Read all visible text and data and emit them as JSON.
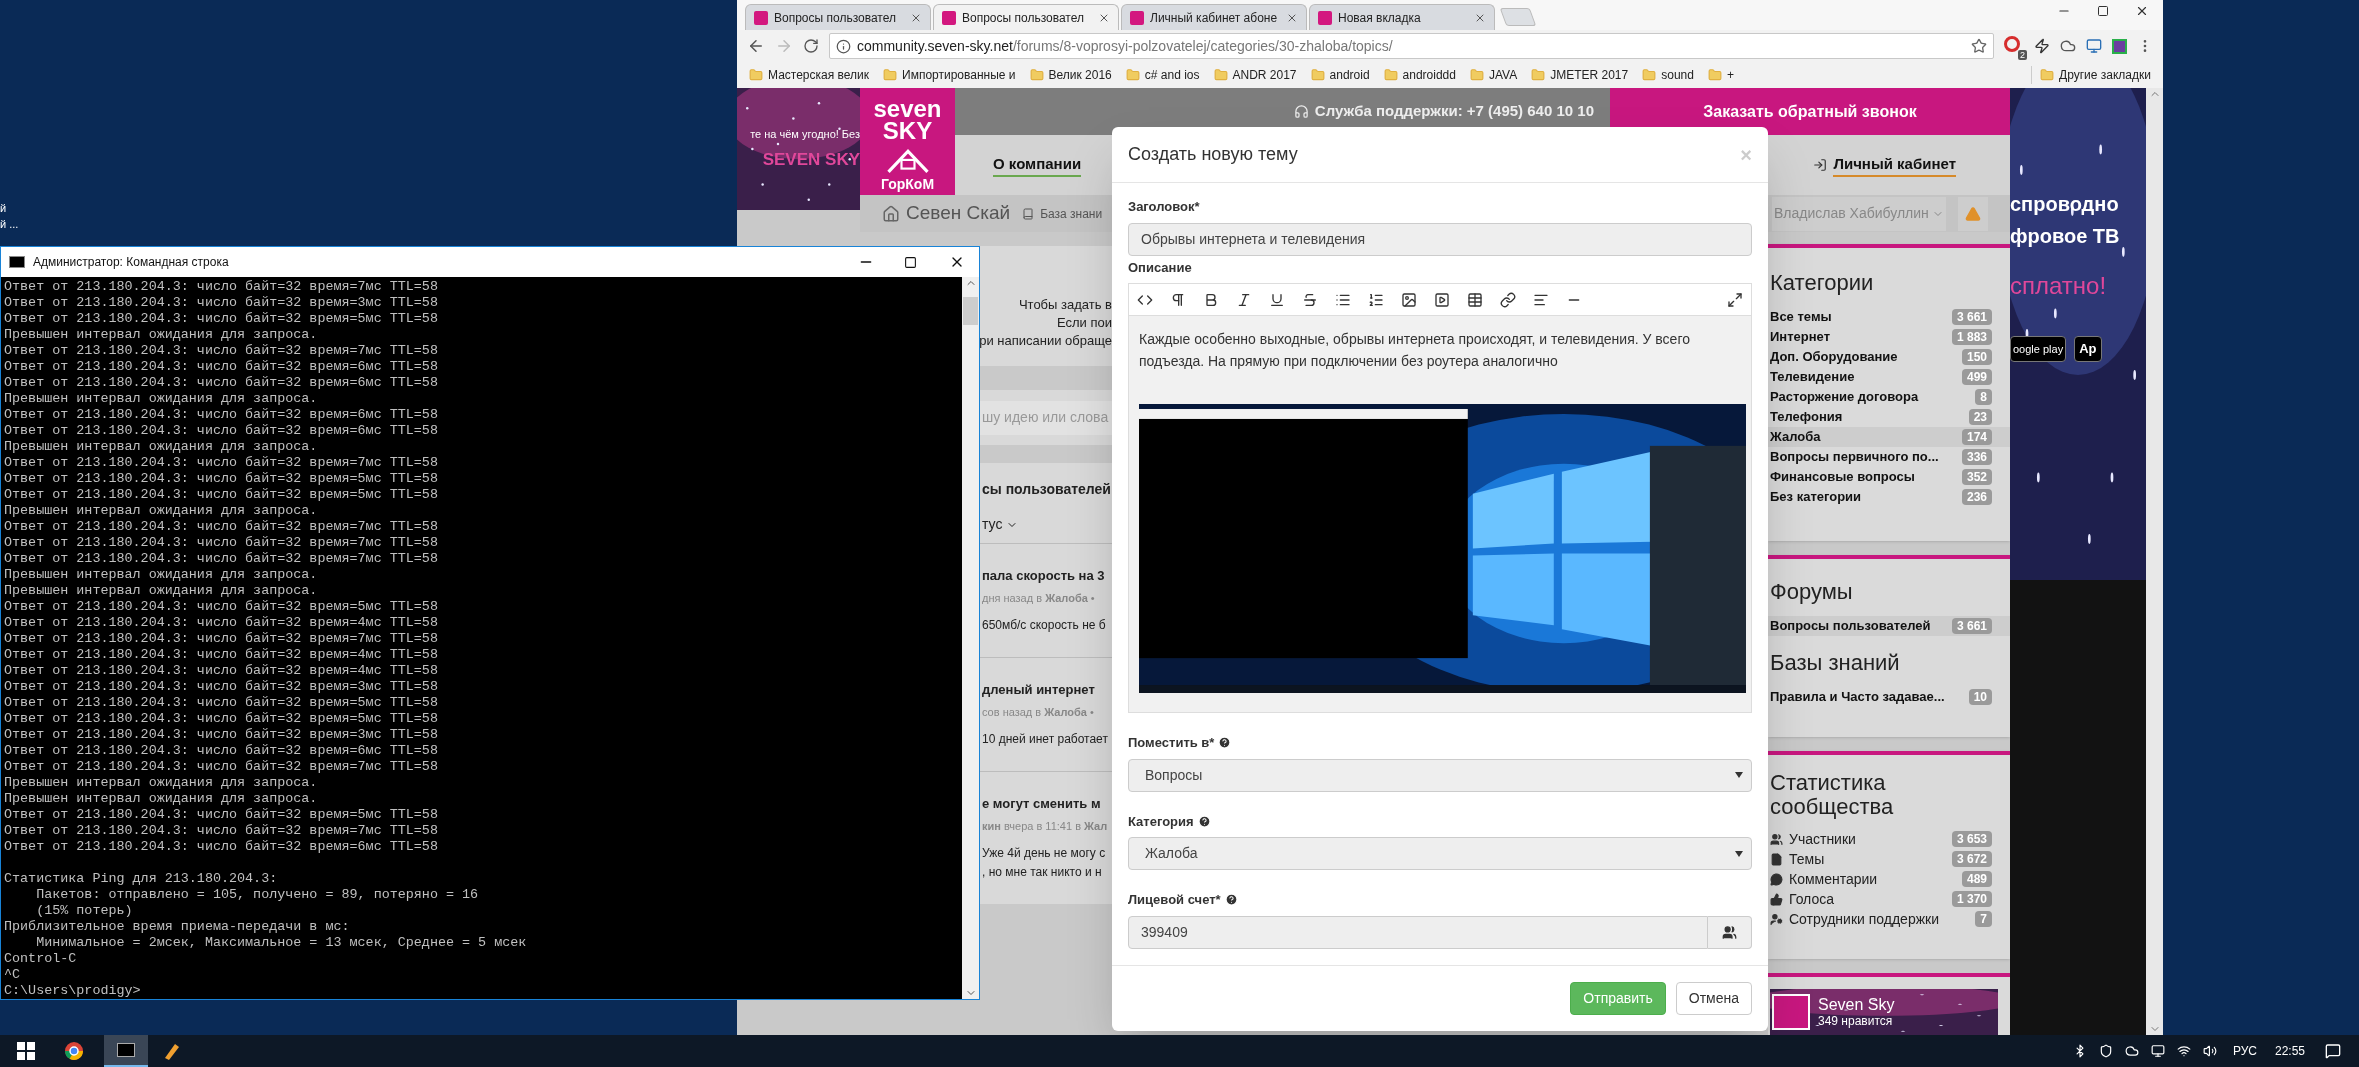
{
  "desktop": {
    "icon_labels": [
      "й",
      "й ..."
    ]
  },
  "browser": {
    "tabs": [
      {
        "label": "Вопросы пользовател",
        "selected": false
      },
      {
        "label": "Вопросы пользовател",
        "selected": true
      },
      {
        "label": "Личный кабинет абоне",
        "selected": false
      },
      {
        "label": "Новая вкладка",
        "selected": false
      }
    ],
    "address": {
      "host": "community.seven-sky.net",
      "path": "/forums/8-voprosyi-polzovatelej/categories/30-zhaloba/topics/"
    },
    "extension_badge": "2",
    "bookmarks": [
      "Мастерская велик",
      "Импортированные и",
      "Велик 2016",
      "c# and ios",
      "ANDR 2017",
      "android",
      "androiddd",
      "JAVA",
      "JMETER 2017",
      "sound",
      "+"
    ],
    "other_bookmarks": "Другие закладки"
  },
  "page": {
    "left_banner": {
      "slogan": "те на чём угодно! Без",
      "brand": "SEVEN SKY"
    },
    "logo": {
      "top": "seven",
      "bottom": "SKY",
      "sub": "ГорКоМ"
    },
    "support": "Служба поддержки: +7 (495) 640 10 10",
    "callback": "Заказать обратный звонок",
    "nav": [
      "О компании",
      "Личный кабинет"
    ],
    "breadcrumb": [
      "Севен Скай",
      "База знани"
    ],
    "user": "Владислав Хабибуллин",
    "intro_lines": [
      "Чтобы задать в",
      "Если пои",
      "ри написании обраще"
    ],
    "search_placeholder": "шу идею или слова",
    "forum_title": "сы пользователей",
    "filter": "тус",
    "topics": [
      {
        "title": "пала скорость на 3",
        "meta": "дня назад в **Жалоба** •",
        "excerpt": [
          "650мб/с скорость не б"
        ]
      },
      {
        "title": "дленый интернет",
        "meta": "сов назад в **Жалоба** •",
        "excerpt": [
          "10 дней инет работает"
        ]
      },
      {
        "title": "е могут сменить м",
        "meta": "**кин** вчера в 11:41 в **Жал**",
        "excerpt": [
          "Уже 4й день не могу с",
          ", но мне так никто и н"
        ]
      }
    ],
    "categories": {
      "title": "Категории",
      "items": [
        {
          "name": "Все темы",
          "count": "3 661",
          "selected": false
        },
        {
          "name": "Интернет",
          "count": "1 883",
          "selected": false
        },
        {
          "name": "Доп. Оборудование",
          "count": "150",
          "selected": false
        },
        {
          "name": "Телевидение",
          "count": "499",
          "selected": false
        },
        {
          "name": "Расторжение договора",
          "count": "8",
          "selected": false
        },
        {
          "name": "Телефония",
          "count": "23",
          "selected": false
        },
        {
          "name": "Жалоба",
          "count": "174",
          "selected": true
        },
        {
          "name": "Вопросы первичного по...",
          "count": "336",
          "selected": false
        },
        {
          "name": "Финансовые вопросы",
          "count": "352",
          "selected": false
        },
        {
          "name": "Без категории",
          "count": "236",
          "selected": false
        }
      ]
    },
    "forums": {
      "title": "Форумы",
      "items": [
        {
          "name": "Вопросы пользователей",
          "count": "3 661",
          "selected": true
        }
      ]
    },
    "knowledge": {
      "title": "Базы знаний",
      "items": [
        {
          "name": "Правила и Часто задавае...",
          "count": "10",
          "selected": false
        }
      ]
    },
    "stats": {
      "title": "Статистика сообщества",
      "items": [
        {
          "kind": "members",
          "label": "Участники",
          "count": "3 653"
        },
        {
          "kind": "topics",
          "label": "Темы",
          "count": "3 672"
        },
        {
          "kind": "comments",
          "label": "Комментарии",
          "count": "489"
        },
        {
          "kind": "votes",
          "label": "Голоса",
          "count": "1 370"
        },
        {
          "kind": "staff",
          "label": "Сотрудники поддержки",
          "count": "7"
        }
      ]
    },
    "social": {
      "name": "Seven Sky",
      "likes": "349 нравится"
    },
    "ad": {
      "lines": [
        "спроводно",
        "фровое ТВ"
      ],
      "highlight": "сплатно!",
      "stores": [
        "oogle play",
        "Ap"
      ]
    }
  },
  "cmd": {
    "title": "Администратор: Командная строка",
    "lines": [
      "Ответ от 213.180.204.3: число байт=32 время=7мс TTL=58",
      "Ответ от 213.180.204.3: число байт=32 время=3мс TTL=58",
      "Ответ от 213.180.204.3: число байт=32 время=5мс TTL=58",
      "Превышен интервал ожидания для запроса.",
      "Ответ от 213.180.204.3: число байт=32 время=7мс TTL=58",
      "Ответ от 213.180.204.3: число байт=32 время=6мс TTL=58",
      "Ответ от 213.180.204.3: число байт=32 время=6мс TTL=58",
      "Превышен интервал ожидания для запроса.",
      "Ответ от 213.180.204.3: число байт=32 время=6мс TTL=58",
      "Ответ от 213.180.204.3: число байт=32 время=6мс TTL=58",
      "Превышен интервал ожидания для запроса.",
      "Ответ от 213.180.204.3: число байт=32 время=7мс TTL=58",
      "Ответ от 213.180.204.3: число байт=32 время=5мс TTL=58",
      "Ответ от 213.180.204.3: число байт=32 время=5мс TTL=58",
      "Превышен интервал ожидания для запроса.",
      "Ответ от 213.180.204.3: число байт=32 время=7мс TTL=58",
      "Ответ от 213.180.204.3: число байт=32 время=7мс TTL=58",
      "Ответ от 213.180.204.3: число байт=32 время=7мс TTL=58",
      "Превышен интервал ожидания для запроса.",
      "Превышен интервал ожидания для запроса.",
      "Ответ от 213.180.204.3: число байт=32 время=5мс TTL=58",
      "Ответ от 213.180.204.3: число байт=32 время=4мс TTL=58",
      "Ответ от 213.180.204.3: число байт=32 время=7мс TTL=58",
      "Ответ от 213.180.204.3: число байт=32 время=4мс TTL=58",
      "Ответ от 213.180.204.3: число байт=32 время=4мс TTL=58",
      "Ответ от 213.180.204.3: число байт=32 время=3мс TTL=58",
      "Ответ от 213.180.204.3: число байт=32 время=5мс TTL=58",
      "Ответ от 213.180.204.3: число байт=32 время=5мс TTL=58",
      "Ответ от 213.180.204.3: число байт=32 время=3мс TTL=58",
      "Ответ от 213.180.204.3: число байт=32 время=6мс TTL=58",
      "Ответ от 213.180.204.3: число байт=32 время=7мс TTL=58",
      "Превышен интервал ожидания для запроса.",
      "Превышен интервал ожидания для запроса.",
      "Ответ от 213.180.204.3: число байт=32 время=5мс TTL=58",
      "Ответ от 213.180.204.3: число байт=32 время=7мс TTL=58",
      "Ответ от 213.180.204.3: число байт=32 время=6мс TTL=58"
    ],
    "summary": [
      "Статистика Ping для 213.180.204.3:",
      "    Пакетов: отправлено = 105, получено = 89, потеряно = 16",
      "    (15% потерь)",
      "Приблизительное время приема-передачи в мс:",
      "    Минимальное = 2мсек, Максимальное = 13 мсек, Среднее = 5 мсек",
      "Control-C",
      "^C",
      "C:\\Users\\prodigy>"
    ]
  },
  "modal": {
    "title": "Создать новую тему",
    "close": "×",
    "title_field": {
      "label": "Заголовок*",
      "value": "Обрывы интернета и телевидения"
    },
    "description": {
      "label": "Описание",
      "text": "Каждые особенно выходные, обрывы интернета происходят, и телевидения. У всего подъезда. На прямую при подключении без роутера аналогично"
    },
    "fields": [
      {
        "kind": "select",
        "label": "Поместить в*",
        "help": true,
        "value": "Вопросы"
      },
      {
        "kind": "select",
        "label": "Категория",
        "help": true,
        "value": "Жалоба"
      },
      {
        "kind": "lookup",
        "label": "Лицевой счет*",
        "help": true,
        "value": "399409"
      }
    ],
    "buttons": [
      {
        "label": "Отправить",
        "kind": "primary"
      },
      {
        "label": "Отмена",
        "kind": "default"
      }
    ]
  },
  "taskbar": {
    "language": "РУС",
    "time": "22:55"
  }
}
